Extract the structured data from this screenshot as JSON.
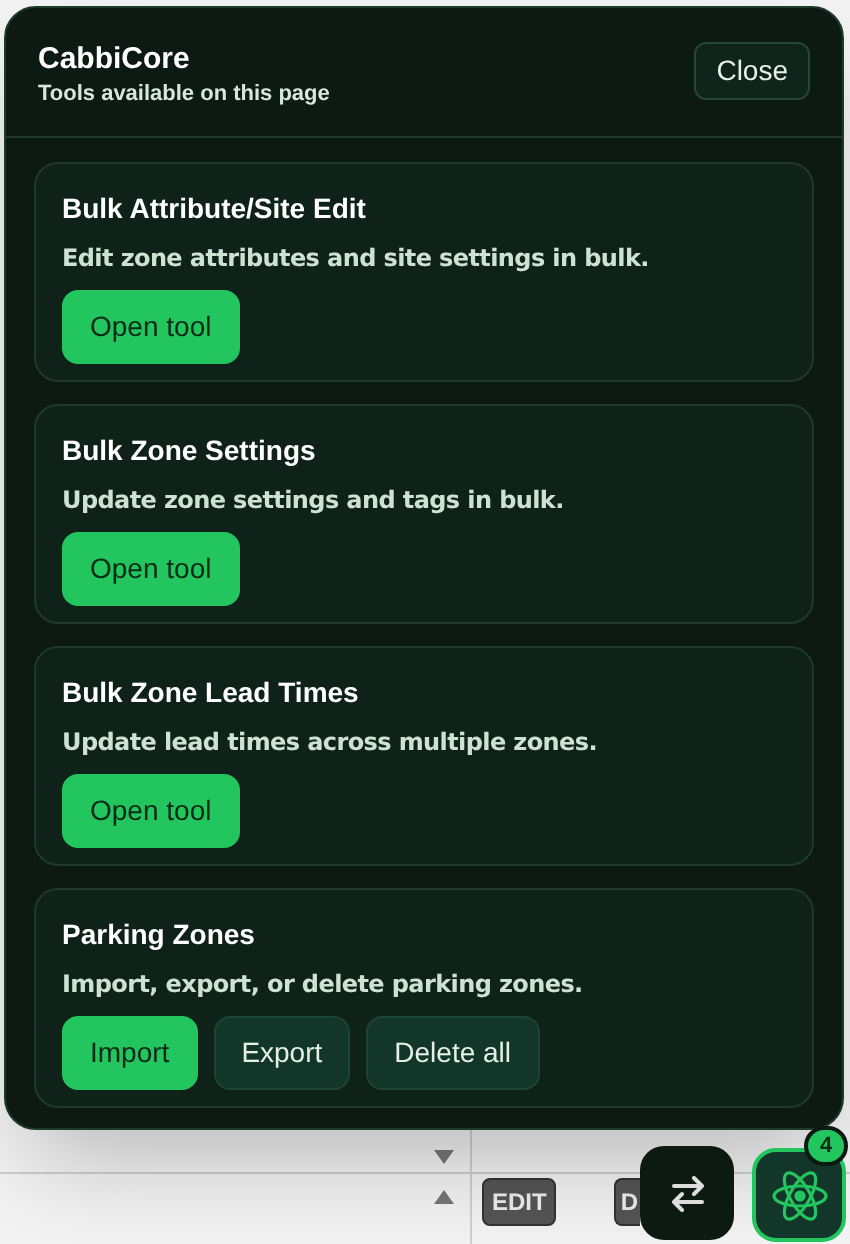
{
  "panel": {
    "title": "CabbiCore",
    "subtitle": "Tools available on this page",
    "close_label": "Close"
  },
  "tools": [
    {
      "title": "Bulk Attribute/Site Edit",
      "description": "Edit zone attributes and site settings in bulk.",
      "buttons": [
        {
          "label": "Open tool",
          "kind": "primary"
        }
      ]
    },
    {
      "title": "Bulk Zone Settings",
      "description": "Update zone settings and tags in bulk.",
      "buttons": [
        {
          "label": "Open tool",
          "kind": "primary"
        }
      ]
    },
    {
      "title": "Bulk Zone Lead Times",
      "description": "Update lead times across multiple zones.",
      "buttons": [
        {
          "label": "Open tool",
          "kind": "primary"
        }
      ]
    },
    {
      "title": "Parking Zones",
      "description": "Import, export, or delete parking zones.",
      "buttons": [
        {
          "label": "Import",
          "kind": "primary"
        },
        {
          "label": "Export",
          "kind": "secondary"
        },
        {
          "label": "Delete all",
          "kind": "secondary"
        }
      ]
    }
  ],
  "background_row": {
    "buttons": [
      "EDIT",
      "D"
    ]
  },
  "launcher": {
    "badge": "4"
  }
}
